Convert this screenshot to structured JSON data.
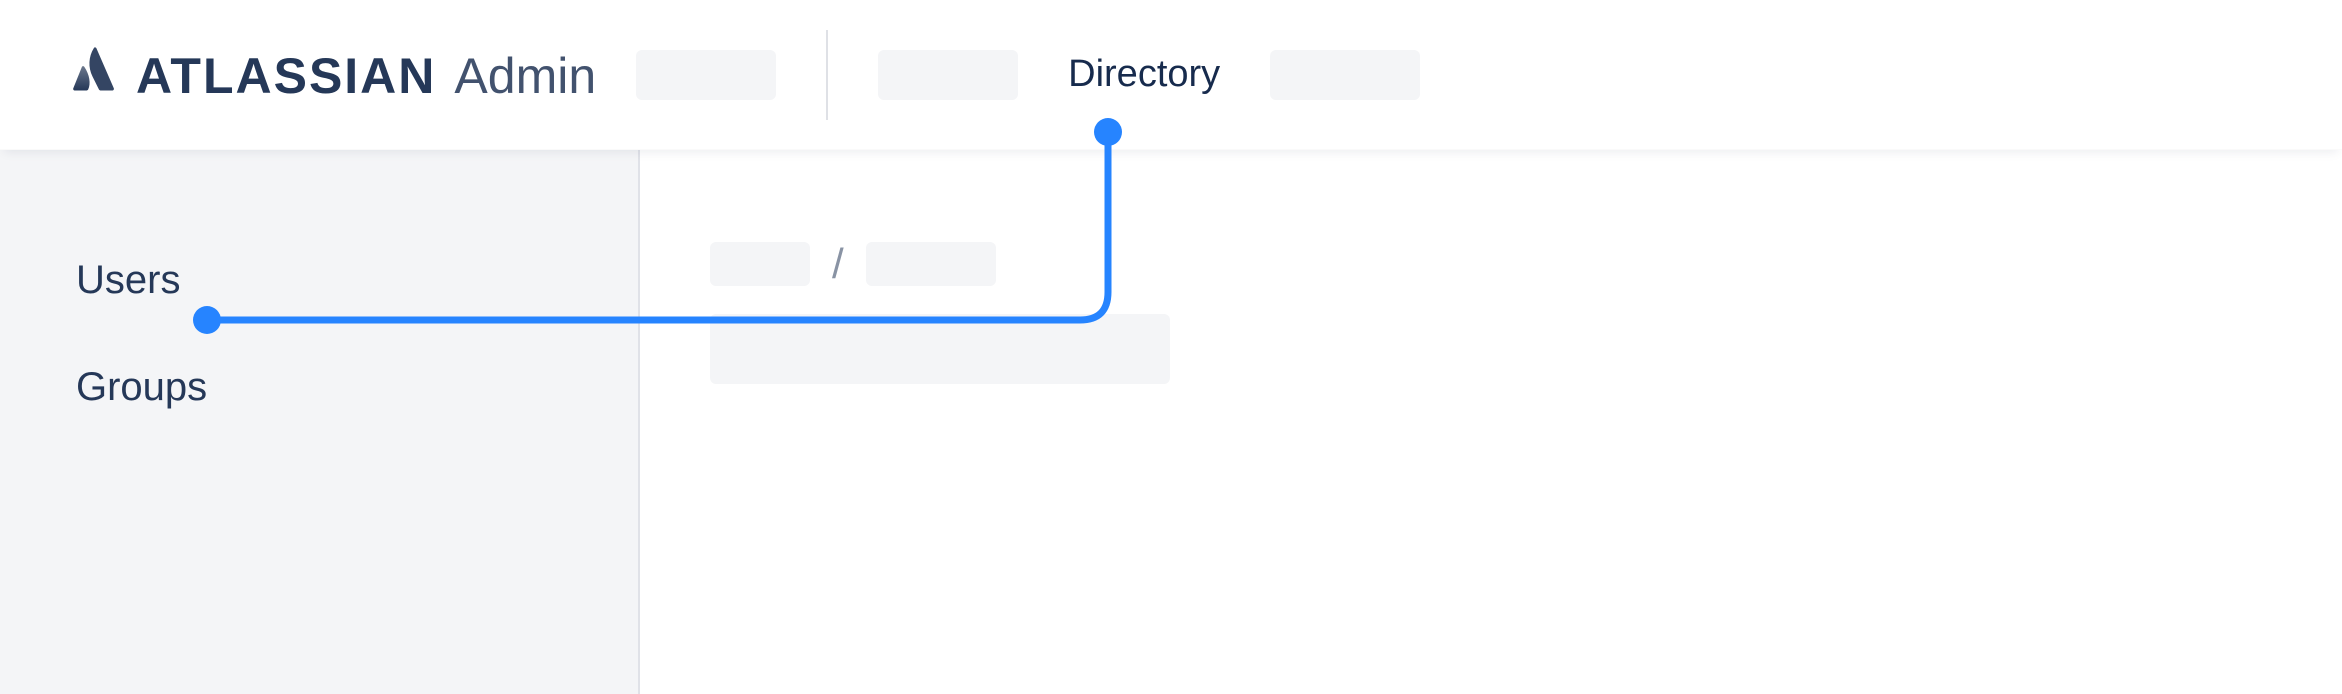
{
  "brand": {
    "name": "ATLASSIAN",
    "suffix": "Admin"
  },
  "nav": {
    "active_label": "Directory"
  },
  "sidebar": {
    "items": [
      {
        "label": "Users"
      },
      {
        "label": "Groups"
      }
    ]
  },
  "breadcrumb": {
    "separator": "/"
  },
  "colors": {
    "accent": "#2684FF",
    "text_primary": "#172B4D",
    "text_secondary": "#42526E",
    "placeholder_bg": "#F4F5F7",
    "sidebar_bg": "#F4F5F7"
  }
}
